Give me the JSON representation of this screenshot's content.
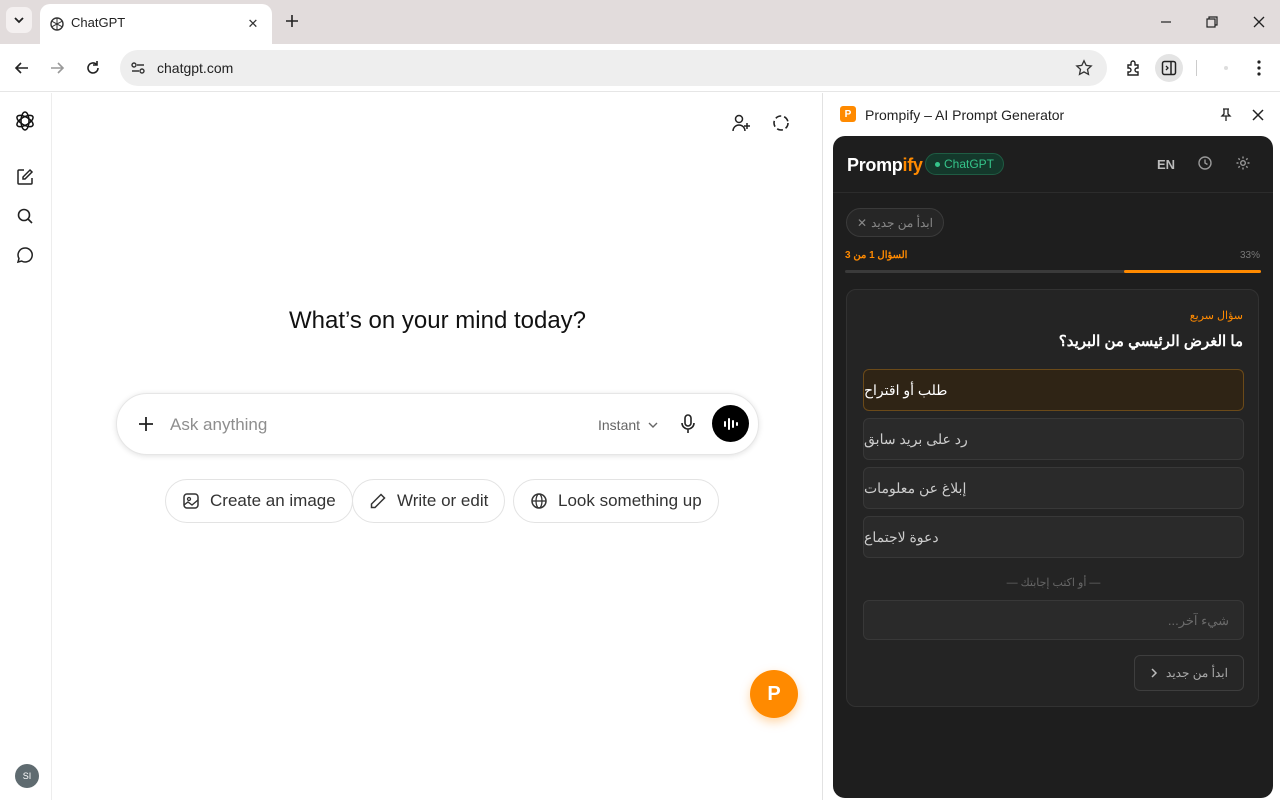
{
  "browser": {
    "tab_title": "ChatGPT",
    "url": "chatgpt.com",
    "tab_close": "✕",
    "new_tab": "+"
  },
  "chatgpt": {
    "headline": "What’s on your mind today?",
    "composer_placeholder": "Ask anything",
    "model_label": "Instant",
    "chips": [
      "Create an image",
      "Write or edit",
      "Look something up"
    ],
    "avatar_initials": "SI",
    "fab_label": "P"
  },
  "sidepanel": {
    "favicon_letter": "P",
    "title": "Prompify – AI Prompt Generator"
  },
  "prompify": {
    "brand_main": "Promp",
    "brand_accent": "ify",
    "badge": "ChatGPT",
    "lang": "EN",
    "restart_chip": "ابدأ من جديد",
    "restart_chip_x": "✕",
    "question_counter": "السؤال 1 من 3",
    "progress_text": "33%",
    "progress": 0.33,
    "question_tag": "سؤال سريع",
    "question": "ما الغرض الرئيسي من البريد؟",
    "options": [
      "طلب أو اقتراح",
      "رد على بريد سابق",
      "إبلاغ عن معلومات",
      "دعوة لاجتماع"
    ],
    "selected_option": 0,
    "or_line": "— أو اكتب إجابتك —",
    "input_placeholder": "شيء آخر...",
    "restart_button": "ابدأ من جديد"
  },
  "colors": {
    "accent": "#ff8a00",
    "panel_bg": "#1e1e1e",
    "badge_green": "#35c48a"
  }
}
